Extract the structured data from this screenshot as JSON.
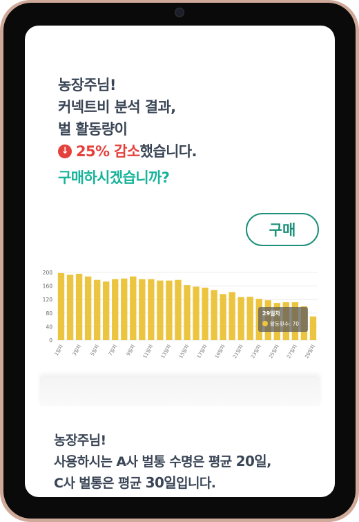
{
  "message1": {
    "greeting": "농장주님!",
    "line2": " 커넥트비 분석 결과,",
    "line3": "벌 활동량이",
    "alert_icon": "arrow-down-icon",
    "alert_highlight": "25% 감소",
    "alert_suffix": "했습니다.",
    "question": "구매하시겠습니까?"
  },
  "buy_button": {
    "label": "구매"
  },
  "tooltip": {
    "title": "29일차",
    "label": "활동횟수: 70"
  },
  "colors": {
    "bar": "#ecc540",
    "alert": "#e5413c",
    "accent": "#17b39a",
    "button": "#1c8f7a"
  },
  "chart_data": {
    "type": "bar",
    "categories": [
      "1일차",
      "2일차",
      "3일차",
      "4일차",
      "5일차",
      "6일차",
      "7일차",
      "8일차",
      "9일차",
      "10일차",
      "11일차",
      "12일차",
      "13일차",
      "14일차",
      "15일차",
      "16일차",
      "17일차",
      "18일차",
      "19일차",
      "20일차",
      "21일차",
      "22일차",
      "23일차",
      "24일차",
      "25일차",
      "26일차",
      "27일차",
      "28일차",
      "29일차"
    ],
    "x_tick_labels": [
      "1일차",
      "3일차",
      "5일차",
      "7일차",
      "9일차",
      "11일차",
      "13일차",
      "15일차",
      "17일차",
      "19일차",
      "21일차",
      "23일차",
      "25일차",
      "27일차",
      "29일차"
    ],
    "values": [
      198,
      193,
      196,
      188,
      178,
      173,
      180,
      182,
      188,
      180,
      180,
      176,
      176,
      178,
      163,
      158,
      155,
      148,
      136,
      142,
      127,
      128,
      122,
      118,
      110,
      112,
      112,
      100,
      70
    ],
    "ylim": [
      0,
      200
    ],
    "yticks": [
      0,
      40,
      80,
      120,
      160,
      200
    ],
    "ytick_labels": [
      "0",
      "40",
      "80",
      "120",
      "160",
      "200"
    ],
    "grid": true,
    "highlight_index": 28
  },
  "message2": {
    "greeting": "농장주님!",
    "line2_pre": "사용하시는 A사 벌통 수명은 평균 ",
    "line2_num": "20일",
    "line2_post": ",",
    "line3_pre": "C사 벌통은 평균 ",
    "line3_num": "30일",
    "line3_post": "입니다."
  }
}
